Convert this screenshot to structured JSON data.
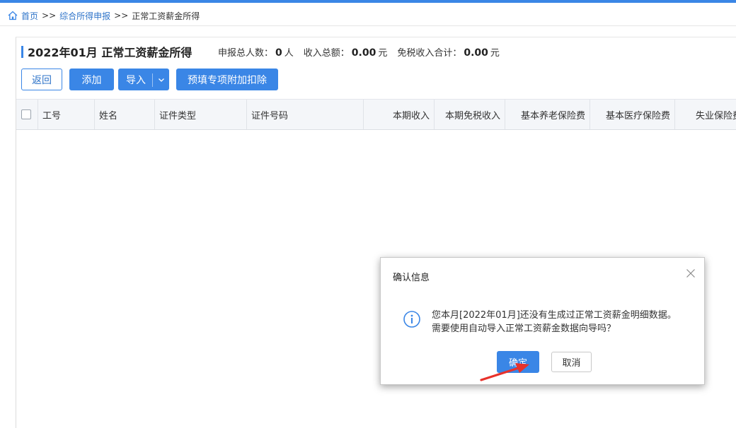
{
  "breadcrumb": {
    "home": "首页",
    "sep": ">>",
    "section": "综合所得申报",
    "current": "正常工资薪金所得"
  },
  "header": {
    "title": "2022年01月 正常工资薪金所得",
    "stats": {
      "people_label": "申报总人数：",
      "people_value": "0",
      "people_unit": "人",
      "income_label": "收入总额：",
      "income_value": "0.00",
      "income_unit": "元",
      "taxfree_label": "免税收入合计：",
      "taxfree_value": "0.00",
      "taxfree_unit": "元"
    }
  },
  "toolbar": {
    "back": "返回",
    "add": "添加",
    "import": "导入",
    "prefill": "预填专项附加扣除"
  },
  "table": {
    "columns": [
      "工号",
      "姓名",
      "证件类型",
      "证件号码",
      "本期收入",
      "本期免税收入",
      "基本养老保险费",
      "基本医疗保险费",
      "失业保险费"
    ]
  },
  "dialog": {
    "title": "确认信息",
    "line1": "您本月[2022年01月]还没有生成过正常工资薪金明细数据。",
    "line2": "需要使用自动导入正常工资薪金数据向导吗？",
    "ok": "确定",
    "cancel": "取消"
  },
  "colors": {
    "accent": "#3a86e6",
    "link": "#2f74c9",
    "annotation": "#e8322b"
  }
}
